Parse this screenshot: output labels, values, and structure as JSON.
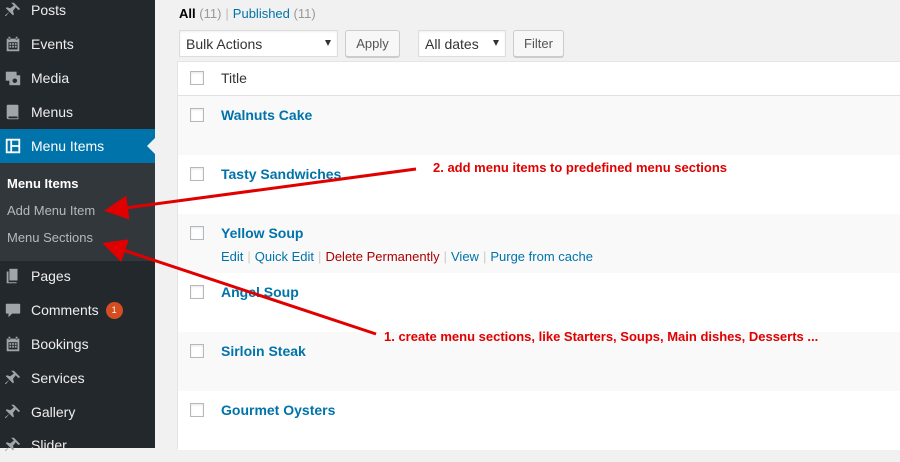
{
  "sidebar": {
    "items": [
      {
        "label": "Posts",
        "icon": "pin-icon"
      },
      {
        "label": "Events",
        "icon": "calendar-icon"
      },
      {
        "label": "Media",
        "icon": "media-icon"
      },
      {
        "label": "Menus",
        "icon": "book-icon"
      },
      {
        "label": "Menu Items",
        "icon": "menu-items-icon",
        "current": true
      },
      {
        "label": "Pages",
        "icon": "pages-icon"
      },
      {
        "label": "Comments",
        "icon": "comment-icon",
        "badge": "1"
      },
      {
        "label": "Bookings",
        "icon": "calendar-icon"
      },
      {
        "label": "Services",
        "icon": "pin-icon"
      },
      {
        "label": "Gallery",
        "icon": "pin-icon"
      },
      {
        "label": "Slider",
        "icon": "pin-icon"
      }
    ],
    "submenu": [
      {
        "label": "Menu Items",
        "current": true
      },
      {
        "label": "Add Menu Item"
      },
      {
        "label": "Menu Sections"
      }
    ],
    "accent_color": "#0073aa",
    "badge_color": "#d54e21"
  },
  "filters": {
    "all_label": "All",
    "all_count": "(11)",
    "separator": "|",
    "published_label": "Published",
    "published_count": "(11)"
  },
  "toolbar": {
    "bulk_actions": "Bulk Actions",
    "apply_label": "Apply",
    "dates": "All dates",
    "filter_label": "Filter"
  },
  "table": {
    "header_title": "Title",
    "rows": [
      {
        "title": "Walnuts Cake"
      },
      {
        "title": "Tasty Sandwiches"
      },
      {
        "title": "Yellow Soup",
        "actions": [
          "Edit",
          "Quick Edit",
          "Delete Permanently",
          "View",
          "Purge from cache"
        ]
      },
      {
        "title": "Angel Soup"
      },
      {
        "title": "Sirloin Steak"
      },
      {
        "title": "Gourmet Oysters"
      }
    ]
  },
  "annotations": {
    "note1": "1. create menu sections, like Starters, Soups, Main dishes, Desserts ...",
    "note2": "2. add menu items to predefined menu sections",
    "color": "#e00000"
  }
}
